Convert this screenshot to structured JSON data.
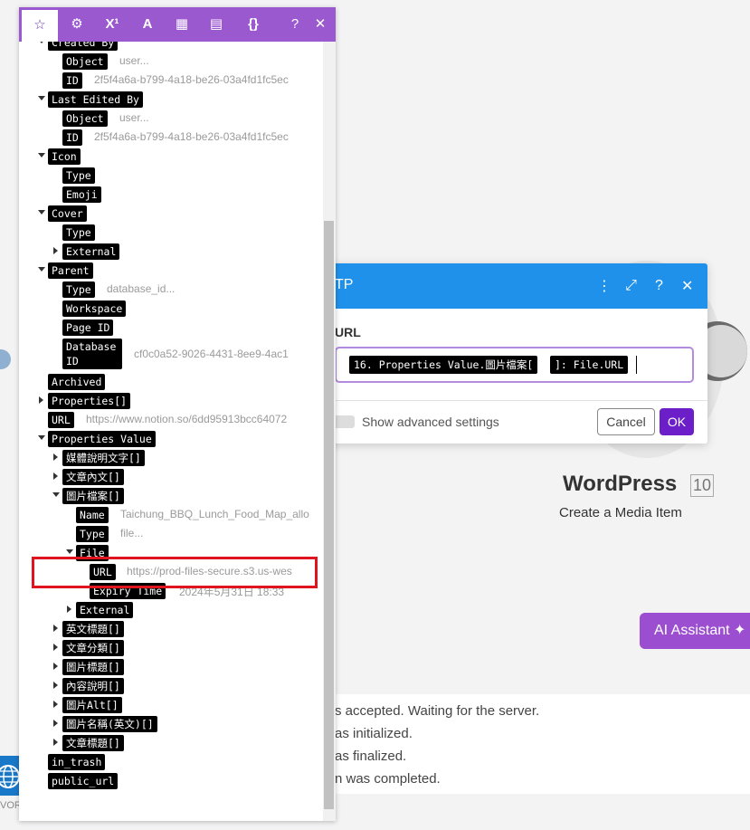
{
  "background": {
    "wordpress_title": "WordPress",
    "wordpress_badge": "10",
    "wordpress_subtitle": "Create a Media Item",
    "ai_assistant_label": "AI Assistant",
    "log_lines": [
      "s accepted. Waiting for the server.",
      "as initialized.",
      "as finalized.",
      "n was completed."
    ],
    "wor_text": "VOR"
  },
  "dialog": {
    "title": "TP",
    "field_label": "URL",
    "input_pills": [
      "16. Properties Value.圖片檔案[",
      "]: File.URL"
    ],
    "advanced_label": "Show advanced settings",
    "cancel_label": "Cancel",
    "ok_label": "OK",
    "header_color": "#1f91ea",
    "ok_color": "#6c1ec9"
  },
  "panel": {
    "tab_color": "#9b59d0",
    "tabs": [
      {
        "name": "star-icon",
        "glyph": "☆"
      },
      {
        "name": "gear-icon",
        "glyph": "⚙"
      },
      {
        "name": "superscript-icon",
        "glyph": "X¹"
      },
      {
        "name": "text-icon",
        "glyph": "A"
      },
      {
        "name": "calendar-icon",
        "glyph": "▦"
      },
      {
        "name": "table-icon",
        "glyph": "▤"
      },
      {
        "name": "braces-icon",
        "glyph": "{}"
      },
      {
        "name": "help-icon",
        "glyph": "?"
      },
      {
        "name": "close-icon",
        "glyph": "✕"
      }
    ],
    "rows": [
      {
        "tag": "Created By",
        "value": ""
      },
      {
        "tag": "Object",
        "value": "user..."
      },
      {
        "tag": "ID",
        "value": "2f5f4a6a-b799-4a18-be26-03a4fd1fc5ec"
      },
      {
        "tag": "Last Edited By",
        "value": ""
      },
      {
        "tag": "Object",
        "value": "user..."
      },
      {
        "tag": "ID",
        "value": "2f5f4a6a-b799-4a18-be26-03a4fd1fc5ec"
      },
      {
        "tag": "Icon",
        "value": ""
      },
      {
        "tag": "Type",
        "value": ""
      },
      {
        "tag": "Emoji",
        "value": ""
      },
      {
        "tag": "Cover",
        "value": ""
      },
      {
        "tag": "Type",
        "value": ""
      },
      {
        "tag": "External",
        "value": ""
      },
      {
        "tag": "Parent",
        "value": ""
      },
      {
        "tag": "Type",
        "value": "database_id..."
      },
      {
        "tag": "Workspace",
        "value": ""
      },
      {
        "tag": "Page ID",
        "value": ""
      },
      {
        "tag": "Database ID",
        "value": "cf0c0a52-9026-4431-8ee9-4ac1"
      },
      {
        "tag": "Archived",
        "value": ""
      },
      {
        "tag": "Properties[]",
        "value": ""
      },
      {
        "tag": "URL",
        "value": "https://www.notion.so/6dd95913bcc64072"
      },
      {
        "tag": "Properties Value",
        "value": ""
      },
      {
        "tag": "媒體說明文字[]",
        "value": ""
      },
      {
        "tag": "文章內文[]",
        "value": ""
      },
      {
        "tag": "圖片檔案[]",
        "value": ""
      },
      {
        "tag": "Name",
        "value": "Taichung_BBQ_Lunch_Food_Map_allo"
      },
      {
        "tag": "Type",
        "value": "file..."
      },
      {
        "tag": "File",
        "value": ""
      },
      {
        "tag": "URL",
        "value": "https://prod-files-secure.s3.us-wes"
      },
      {
        "tag": "Expiry Time",
        "value": "2024年5月31日 18:33"
      },
      {
        "tag": "External",
        "value": ""
      },
      {
        "tag": "英文標題[]",
        "value": ""
      },
      {
        "tag": "文章分類[]",
        "value": ""
      },
      {
        "tag": "圖片標題[]",
        "value": ""
      },
      {
        "tag": "內容說明[]",
        "value": ""
      },
      {
        "tag": "圖片Alt[]",
        "value": ""
      },
      {
        "tag": "圖片名稱(英文)[]",
        "value": ""
      },
      {
        "tag": "文章標題[]",
        "value": ""
      },
      {
        "tag": "in_trash",
        "value": ""
      },
      {
        "tag": "public_url",
        "value": ""
      }
    ]
  }
}
